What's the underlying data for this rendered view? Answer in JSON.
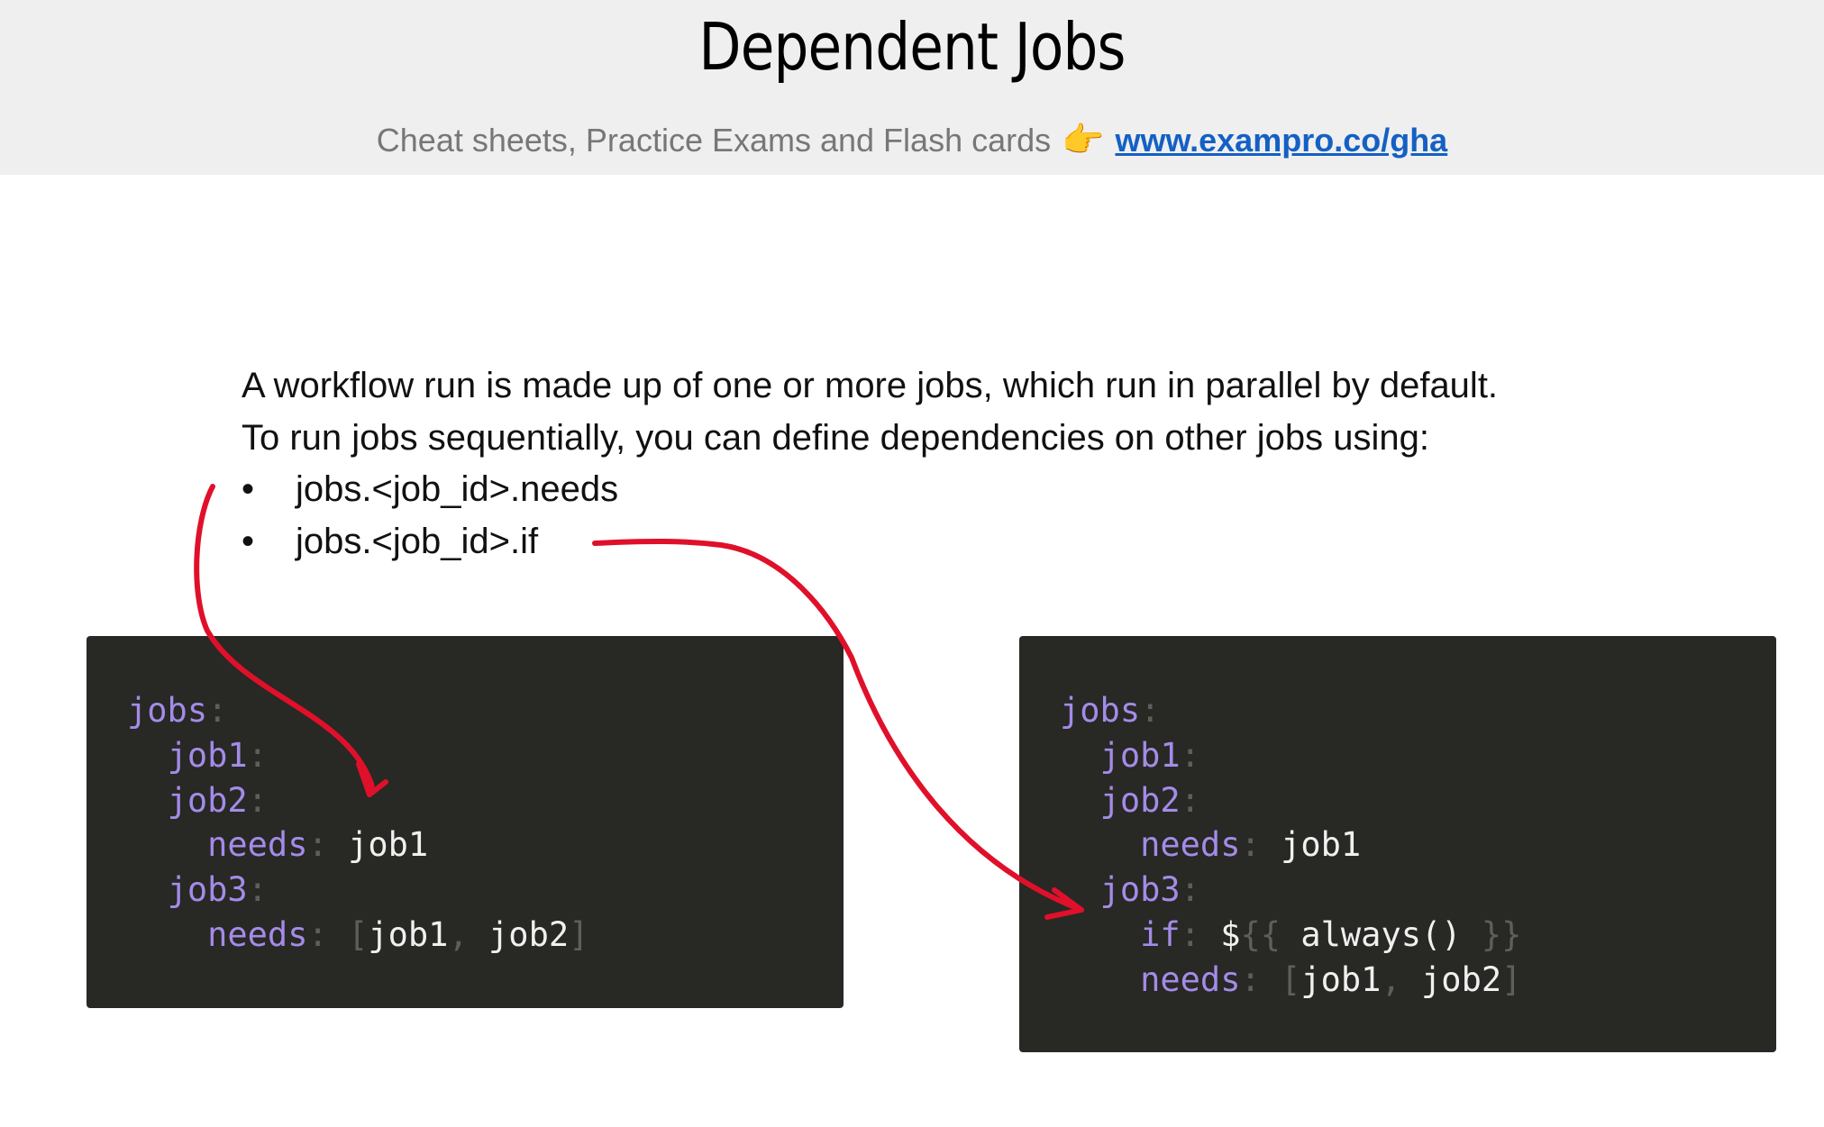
{
  "header": {
    "title": "Dependent Jobs",
    "subtitle": "Cheat sheets, Practice Exams and Flash cards",
    "hand_icon": "👉",
    "link": "www.exampro.co/gha"
  },
  "body": {
    "line1": "A workflow run is made up of one or more jobs, which run in parallel by default.",
    "line2": "To run jobs sequentially, you can define dependencies on other jobs using:",
    "bullets": [
      "jobs.<job_id>.needs",
      "jobs.<job_id>.if"
    ]
  },
  "code_left": {
    "jobs": "jobs",
    "job1": "job1",
    "job2": "job2",
    "needs": "needs",
    "job2_needs": "job1",
    "job3": "job3",
    "job3_needs_a": "job1",
    "job3_needs_b": "job2"
  },
  "code_right": {
    "jobs": "jobs",
    "job1": "job1",
    "job2": "job2",
    "needs": "needs",
    "job2_needs": "job1",
    "job3": "job3",
    "if": "if",
    "dollar": "$",
    "expr": "always()",
    "job3_needs_a": "job1",
    "job3_needs_b": "job2"
  },
  "colors": {
    "annotation": "#e0102a",
    "key": "#a48be8",
    "code_bg": "#282824"
  }
}
